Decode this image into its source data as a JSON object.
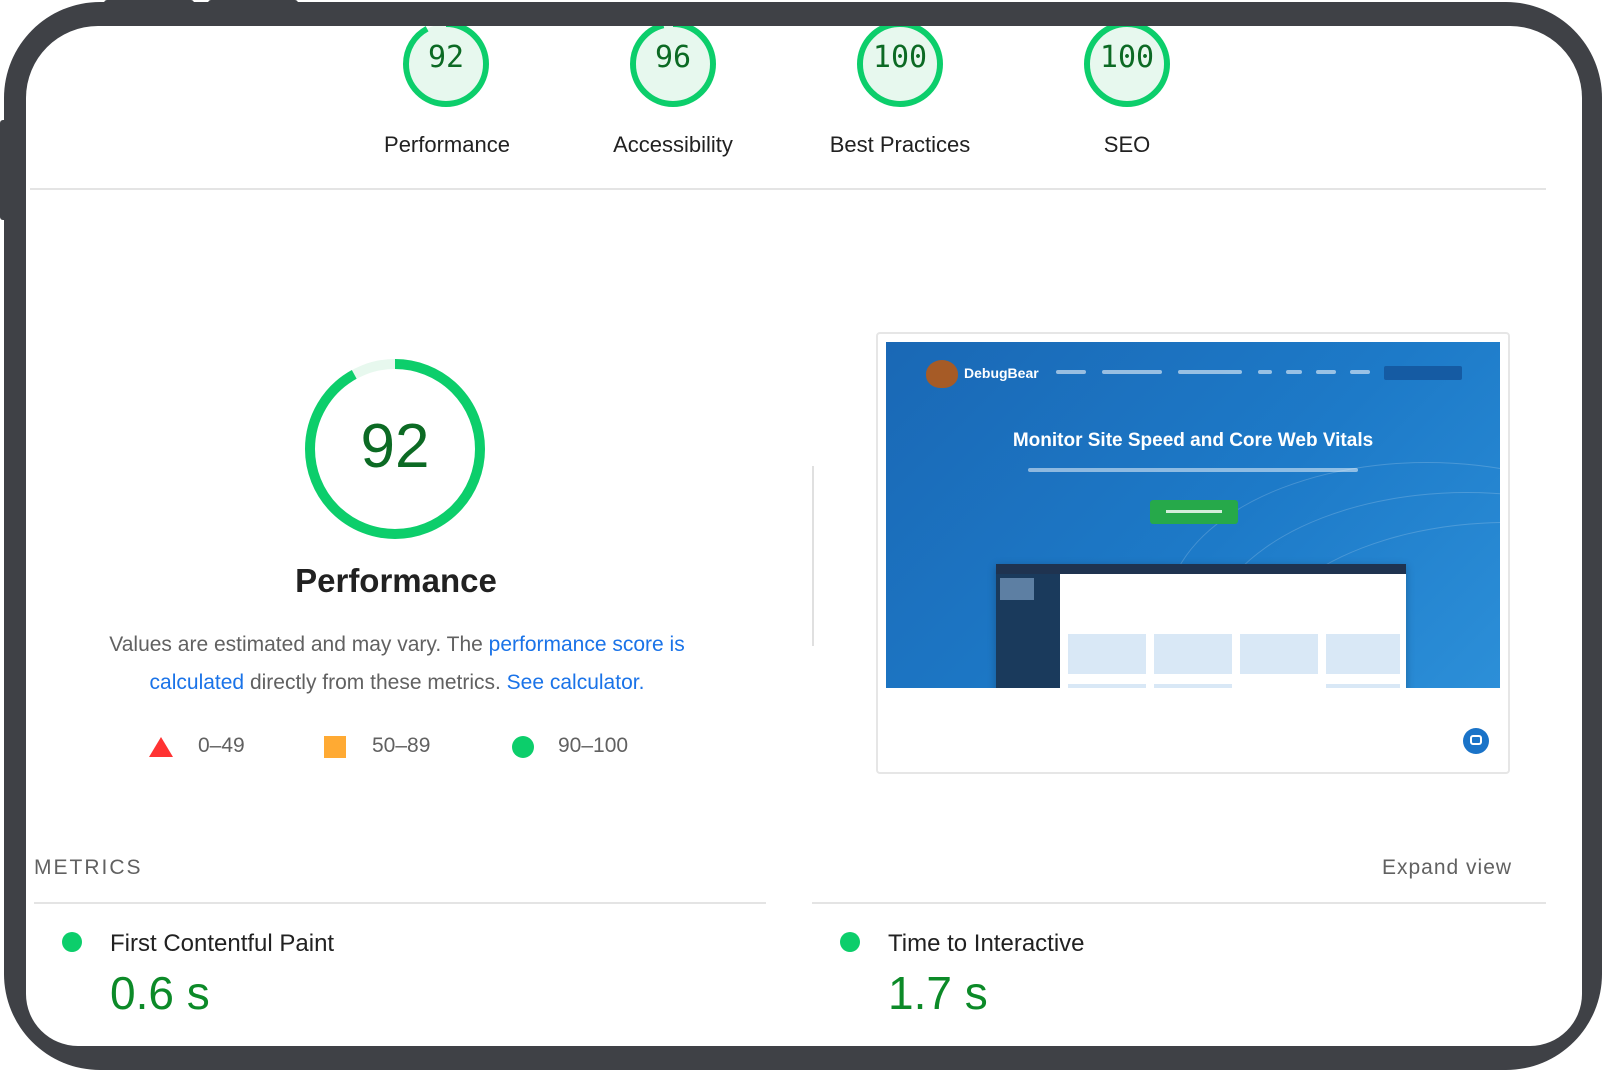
{
  "categories": [
    {
      "label": "Performance",
      "score": "92",
      "fraction": 0.92
    },
    {
      "label": "Accessibility",
      "score": "96",
      "fraction": 0.96
    },
    {
      "label": "Best Practices",
      "score": "100",
      "fraction": 1.0
    },
    {
      "label": "SEO",
      "score": "100",
      "fraction": 1.0
    }
  ],
  "performance": {
    "score": "92",
    "fraction": 0.92,
    "title": "Performance",
    "desc_1": "Values are estimated and may vary. The ",
    "link_score": "performance score is calculated",
    "desc_2": " directly from these metrics. ",
    "link_calc": "See calculator.",
    "legend": [
      {
        "range": "0–49",
        "color": "#ff3333",
        "shape": "triangle"
      },
      {
        "range": "50–89",
        "color": "#ffaa33",
        "shape": "square"
      },
      {
        "range": "90–100",
        "color": "#0cce6b",
        "shape": "circle"
      }
    ]
  },
  "screenshot": {
    "brand": "DebugBear",
    "headline": "Monitor Site Speed and Core Web Vitals"
  },
  "metrics": {
    "label": "METRICS",
    "expand": "Expand view",
    "items": [
      {
        "name": "First Contentful Paint",
        "value": "0.6 s"
      },
      {
        "name": "Time to Interactive",
        "value": "1.7 s"
      }
    ]
  },
  "colors": {
    "pass": "#0cce6b",
    "pass_text": "#0c6a24",
    "link": "#1a73e8"
  }
}
